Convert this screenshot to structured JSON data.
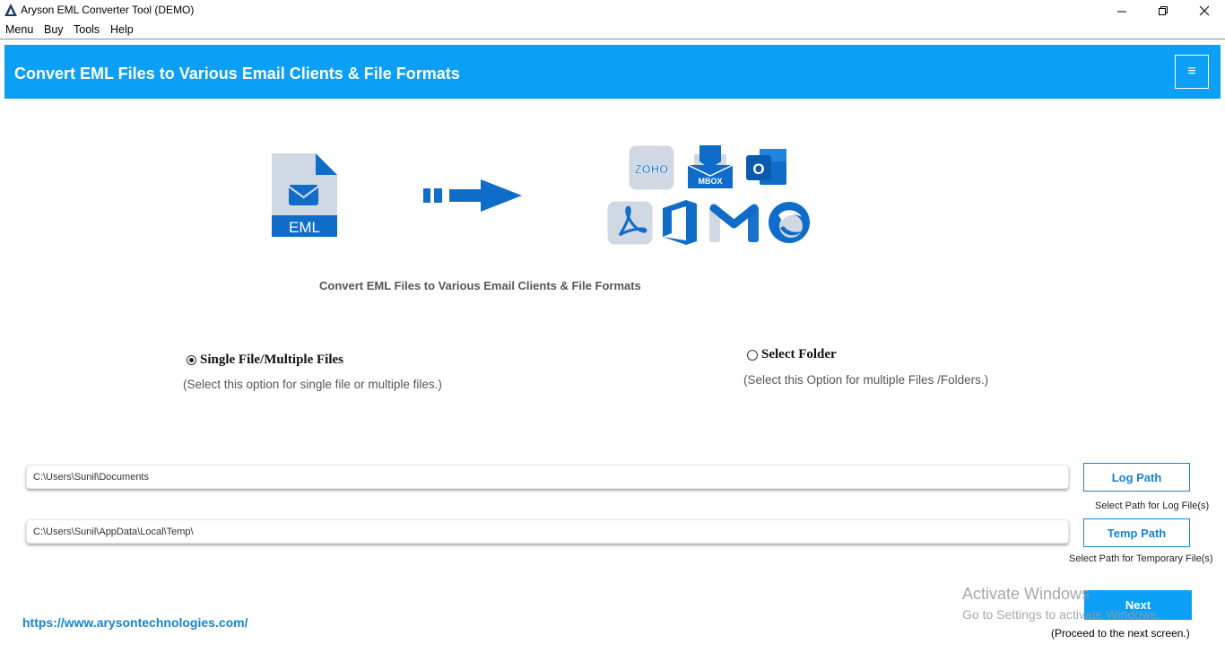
{
  "window": {
    "title": "Aryson EML Converter Tool (DEMO)",
    "controls": {
      "minimize": "—",
      "maximize": "❐",
      "close": "✕"
    }
  },
  "menubar": {
    "items": [
      "Menu",
      "Buy",
      "Tools",
      "Help"
    ]
  },
  "banner": {
    "title": "Convert EML Files to Various Email Clients & File Formats",
    "menu_icon": "≡"
  },
  "hero": {
    "source_icon_label": "EML",
    "target_icons": [
      "zoho-icon",
      "mbox-icon",
      "outlook-icon",
      "pdf-icon",
      "office365-icon",
      "gmail-icon",
      "thunderbird-icon"
    ],
    "zoho_label": "ZOHO",
    "mbox_label": "MBOX",
    "outlook_label": "O",
    "caption": "Convert EML Files to Various Email Clients & File Formats"
  },
  "options": {
    "single": {
      "label": "Single File/Multiple Files",
      "desc": "(Select this option for single file or multiple files.)",
      "selected": true
    },
    "folder": {
      "label": "Select Folder",
      "desc": "(Select this Option for multiple Files /Folders.)",
      "selected": false
    }
  },
  "paths": {
    "log": {
      "value": "C:\\Users\\Sunil\\Documents",
      "button": "Log Path",
      "hint": "Select Path for Log File(s)"
    },
    "temp": {
      "value": "C:\\Users\\Sunil\\AppData\\Local\\Temp\\",
      "button": "Temp Path",
      "hint": "Select Path for Temporary File(s)"
    }
  },
  "footer": {
    "url": "https://www.arysontechnologies.com/",
    "next_button": "Next",
    "next_hint": "(Proceed to the next screen.)"
  },
  "watermark": {
    "line1": "Activate Windows",
    "line2": "Go to Settings to activate Windows."
  },
  "colors": {
    "accent": "#0ba0f5",
    "button_border": "#1584d2",
    "icon_blue": "#0f6cc9"
  }
}
